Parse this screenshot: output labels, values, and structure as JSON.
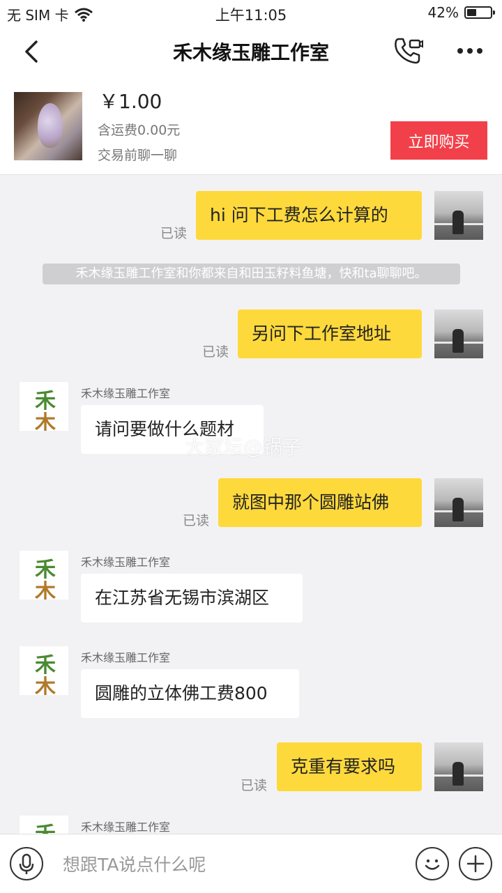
{
  "status": {
    "carrier": "无 SIM 卡",
    "time": "上午11:05",
    "battery": "42%",
    "battery_level": 0.42
  },
  "nav": {
    "title": "禾木缘玉雕工作室"
  },
  "product": {
    "price": "￥1.00",
    "shipping": "含运费0.00元",
    "note": "交易前聊一聊",
    "buy_label": "立即购买"
  },
  "shop_logo": {
    "top": "禾",
    "bottom": "木"
  },
  "messages": [
    {
      "text": "hi 问下工费怎么计算的",
      "read": "已读"
    },
    {
      "system": "禾木缘玉雕工作室和你都来自和田玉籽料鱼塘，快和ta聊聊吧。"
    },
    {
      "text": "另问下工作室地址",
      "read": "已读"
    },
    {
      "sender": "禾木缘玉雕工作室",
      "text": "请问要做什么题材"
    },
    {
      "text": "就图中那个圆雕站佛",
      "read": "已读"
    },
    {
      "sender": "禾木缘玉雕工作室",
      "text": "在江苏省无锡市滨湖区"
    },
    {
      "sender": "禾木缘玉雕工作室",
      "text": "圆雕的立体佛工费800"
    },
    {
      "text": "克重有要求吗",
      "read": "已读"
    },
    {
      "sender": "禾木缘玉雕工作室"
    }
  ],
  "watermark": "大家坛@锅子",
  "input": {
    "placeholder": "想跟TA说点什么呢"
  }
}
